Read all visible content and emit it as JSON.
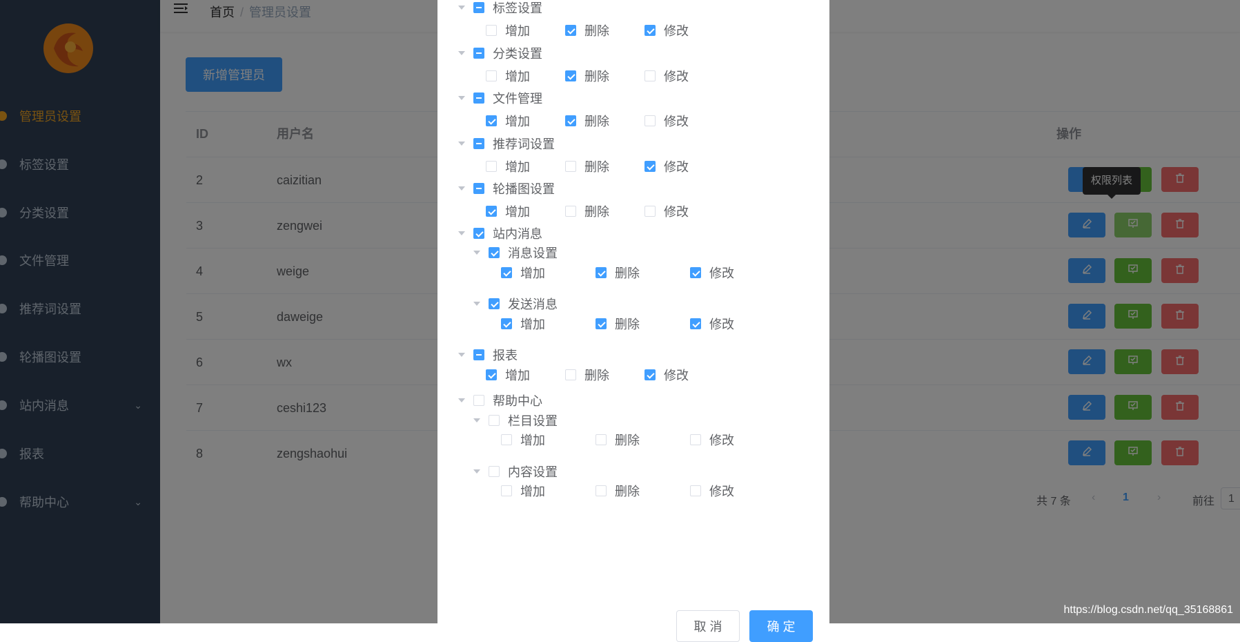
{
  "breadcrumb": {
    "home": "首页",
    "separator": "/",
    "current": "管理员设置"
  },
  "sidebar": {
    "items": [
      {
        "label": "管理员设置",
        "active": true
      },
      {
        "label": "标签设置"
      },
      {
        "label": "分类设置"
      },
      {
        "label": "文件管理"
      },
      {
        "label": "推荐词设置"
      },
      {
        "label": "轮播图设置"
      },
      {
        "label": "站内消息",
        "has_submenu": true
      },
      {
        "label": "报表"
      },
      {
        "label": "帮助中心",
        "has_submenu": true
      }
    ]
  },
  "main": {
    "add_button": "新增管理员",
    "table": {
      "headers": {
        "id": "ID",
        "username": "用户名",
        "actions": "操作"
      },
      "rows": [
        {
          "id": "2",
          "username": "caizitian"
        },
        {
          "id": "3",
          "username": "zengwei"
        },
        {
          "id": "4",
          "username": "weige"
        },
        {
          "id": "5",
          "username": "daweige"
        },
        {
          "id": "6",
          "username": "wx"
        },
        {
          "id": "7",
          "username": "ceshi123"
        },
        {
          "id": "8",
          "username": "zengshaohui"
        }
      ]
    },
    "tooltip": "权限列表",
    "pagination": {
      "total": "共 7 条",
      "current_page": "1",
      "goto": "前往",
      "goto_value": "1"
    }
  },
  "dialog": {
    "actions": [
      "增加",
      "删除",
      "修改"
    ],
    "tree": [
      {
        "label": "标签设置",
        "state": "indeterminate",
        "checks": [
          false,
          true,
          true
        ]
      },
      {
        "label": "分类设置",
        "state": "indeterminate",
        "checks": [
          false,
          true,
          false
        ]
      },
      {
        "label": "文件管理",
        "state": "indeterminate",
        "checks": [
          true,
          true,
          false
        ]
      },
      {
        "label": "推荐词设置",
        "state": "indeterminate",
        "checks": [
          false,
          false,
          true
        ]
      },
      {
        "label": "轮播图设置",
        "state": "indeterminate",
        "checks": [
          true,
          false,
          false
        ]
      },
      {
        "label": "站内消息",
        "state": "checked",
        "children": [
          {
            "label": "消息设置",
            "state": "checked",
            "checks": [
              true,
              true,
              true
            ]
          },
          {
            "label": "发送消息",
            "state": "checked",
            "checks": [
              true,
              true,
              true
            ]
          }
        ]
      },
      {
        "label": "报表",
        "state": "indeterminate",
        "checks": [
          true,
          false,
          true
        ]
      },
      {
        "label": "帮助中心",
        "state": "unchecked",
        "children": [
          {
            "label": "栏目设置",
            "state": "unchecked",
            "checks": [
              false,
              false,
              false
            ]
          },
          {
            "label": "内容设置",
            "state": "unchecked",
            "checks": [
              false,
              false,
              false
            ]
          }
        ]
      }
    ],
    "cancel_label": "取 消",
    "confirm_label": "确 定"
  },
  "watermark": "https://blog.csdn.net/qq_35168861",
  "colors": {
    "sidebar": "#304156",
    "primary": "#409eff",
    "success": "#67c23a",
    "danger": "#f56c6c",
    "active": "#f5a623"
  }
}
